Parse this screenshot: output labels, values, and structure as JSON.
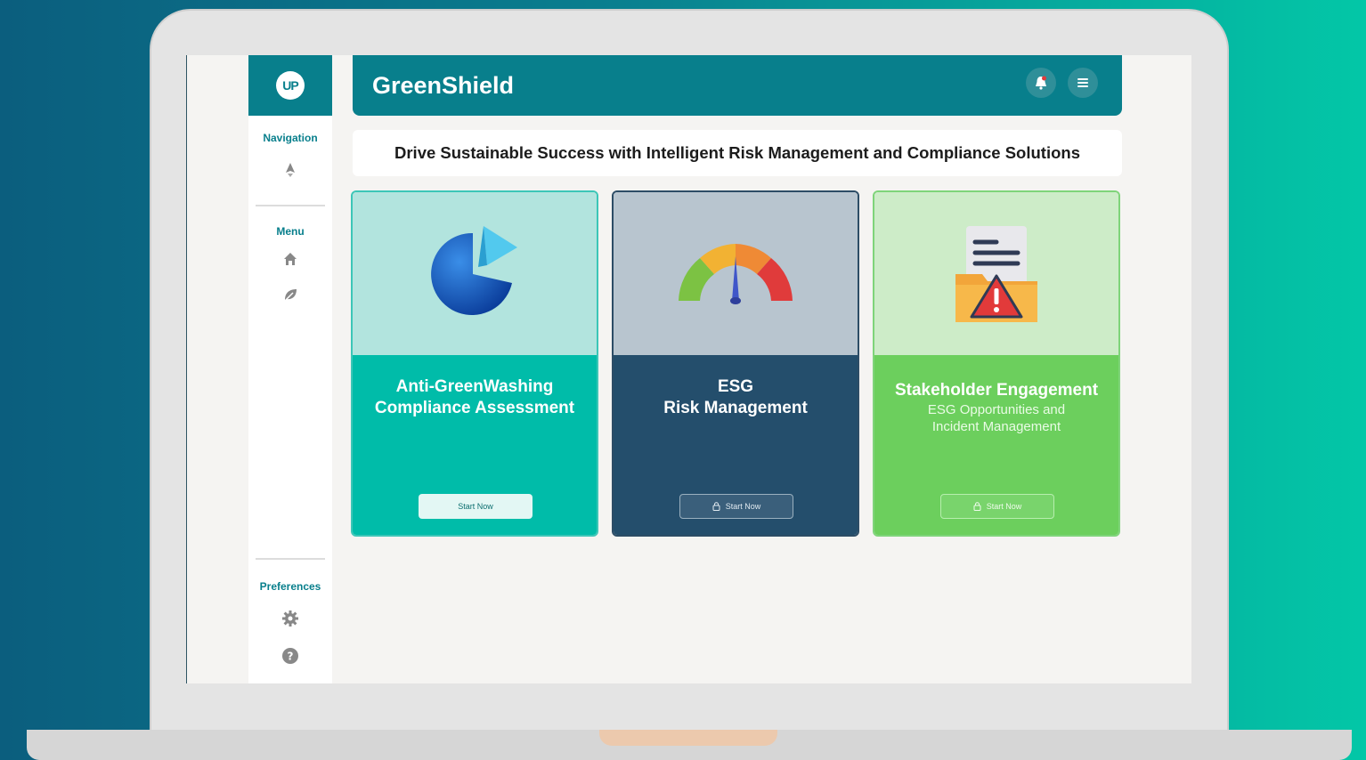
{
  "app": {
    "title": "GreenShield",
    "logo_text": "UP"
  },
  "header": {
    "notification_icon": "bell-icon",
    "menu_icon": "hamburger-menu-icon",
    "tagline": "Drive Sustainable Success with Intelligent Risk Management and Compliance Solutions"
  },
  "sidebar": {
    "navigation_label": "Navigation",
    "navigation_icon": "rocket-icon",
    "menu_label": "Menu",
    "menu_icons": [
      "home-icon",
      "leaf-icon"
    ],
    "preferences_label": "Preferences",
    "preferences_icons": [
      "gear-icon",
      "help-icon"
    ]
  },
  "cards": [
    {
      "title_line1": "Anti-GreenWashing",
      "title_line2": "Compliance Assessment",
      "subtitle_line1": "",
      "subtitle_line2": "",
      "button_label": "Start Now",
      "locked": false,
      "illustration": "pie-chart-icon"
    },
    {
      "title_line1": "ESG",
      "title_line2": "Risk Management",
      "subtitle_line1": "",
      "subtitle_line2": "",
      "button_label": "Start Now",
      "locked": true,
      "illustration": "gauge-icon"
    },
    {
      "title_line1": "Stakeholder Engagement",
      "title_line2": "",
      "subtitle_line1": "ESG Opportunities and",
      "subtitle_line2": "Incident Management",
      "button_label": "Start Now",
      "locked": true,
      "illustration": "warning-folder-icon"
    }
  ],
  "colors": {
    "brand": "#087f8c",
    "card1": "#00bca9",
    "card2": "#244e6c",
    "card3": "#6ccf5d"
  }
}
